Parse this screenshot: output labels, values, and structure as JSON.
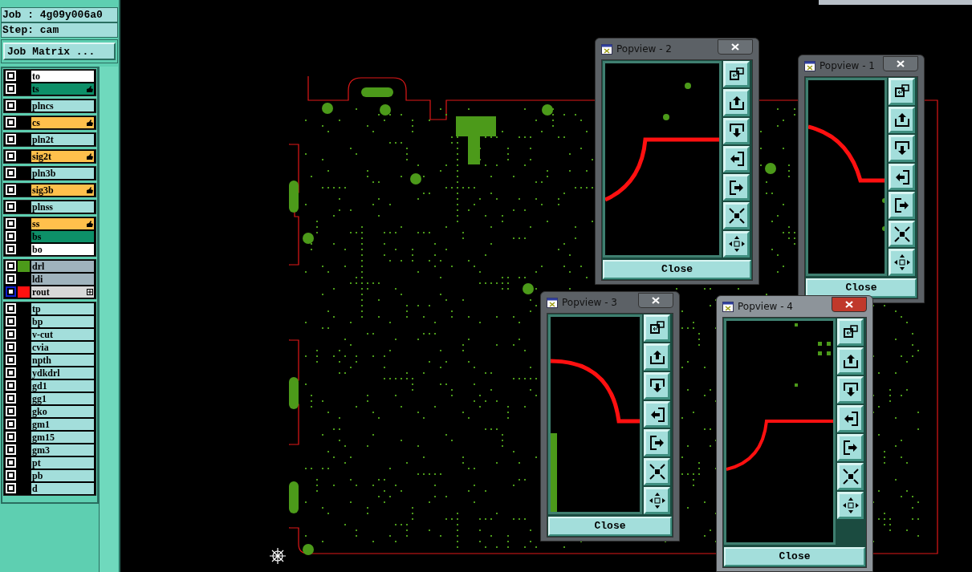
{
  "job_label": "Job : 4g09y006a0",
  "step_label": "Step: cam",
  "job_matrix_button": "Job Matrix ...",
  "layer_groups": [
    [
      {
        "name": "to",
        "kind": "silk",
        "affected": false,
        "selected": false
      },
      {
        "name": "ts",
        "kind": "mask",
        "affected": true,
        "selected": false
      }
    ],
    [
      {
        "name": "plncs",
        "kind": "plane",
        "affected": false,
        "selected": false
      }
    ],
    [
      {
        "name": "cs",
        "kind": "signal",
        "affected": true,
        "selected": false
      }
    ],
    [
      {
        "name": "pln2t",
        "kind": "plane",
        "affected": false,
        "selected": false
      }
    ],
    [
      {
        "name": "sig2t",
        "kind": "signal",
        "affected": true,
        "selected": false
      }
    ],
    [
      {
        "name": "pln3b",
        "kind": "plane",
        "affected": false,
        "selected": false
      }
    ],
    [
      {
        "name": "sig3b",
        "kind": "signal",
        "affected": true,
        "selected": false
      }
    ],
    [
      {
        "name": "plnss",
        "kind": "plane",
        "affected": false,
        "selected": false
      }
    ],
    [
      {
        "name": "ss",
        "kind": "signal",
        "affected": true,
        "selected": false
      },
      {
        "name": "bs",
        "kind": "mask",
        "affected": false,
        "selected": false
      },
      {
        "name": "bo",
        "kind": "silk",
        "affected": false,
        "selected": false
      }
    ],
    [
      {
        "name": "drl",
        "kind": "drill",
        "affected": false,
        "selected": false,
        "color": "#4c9a1a"
      },
      {
        "name": "ldi",
        "kind": "drill",
        "affected": false,
        "selected": false
      },
      {
        "name": "rout",
        "kind": "rout",
        "affected": false,
        "focused": true,
        "color": "#ff1010",
        "expandable": true
      }
    ],
    [
      {
        "name": "tp",
        "kind": "doc",
        "affected": false,
        "selected": false
      },
      {
        "name": "bp",
        "kind": "doc",
        "affected": false,
        "selected": false
      },
      {
        "name": "v-cut",
        "kind": "doc",
        "affected": false,
        "selected": false
      },
      {
        "name": "cvia",
        "kind": "doc",
        "affected": false,
        "selected": false
      },
      {
        "name": "npth",
        "kind": "doc",
        "affected": false,
        "selected": false
      },
      {
        "name": "ydkdrl",
        "kind": "doc",
        "affected": false,
        "selected": false
      },
      {
        "name": "gd1",
        "kind": "doc",
        "affected": false,
        "selected": false
      },
      {
        "name": "gg1",
        "kind": "doc",
        "affected": false,
        "selected": false
      },
      {
        "name": "gko",
        "kind": "doc",
        "affected": false,
        "selected": false
      },
      {
        "name": "gm1",
        "kind": "doc",
        "affected": false,
        "selected": false
      },
      {
        "name": "gm15",
        "kind": "doc",
        "affected": false,
        "selected": false
      },
      {
        "name": "gm3",
        "kind": "doc",
        "affected": false,
        "selected": false
      },
      {
        "name": "pt",
        "kind": "doc",
        "affected": false,
        "selected": false
      },
      {
        "name": "pb",
        "kind": "doc",
        "affected": false,
        "selected": false
      },
      {
        "name": "d",
        "kind": "doc",
        "affected": false,
        "selected": false
      }
    ]
  ],
  "popviews": [
    {
      "title": "Popview - 2",
      "active": false,
      "close_button": "Close"
    },
    {
      "title": "Popview - 1",
      "active": false,
      "close_button": "Close"
    },
    {
      "title": "Popview - 3",
      "active": false,
      "close_button": "Close"
    },
    {
      "title": "Popview - 4",
      "active": true,
      "close_button": "Close"
    }
  ]
}
